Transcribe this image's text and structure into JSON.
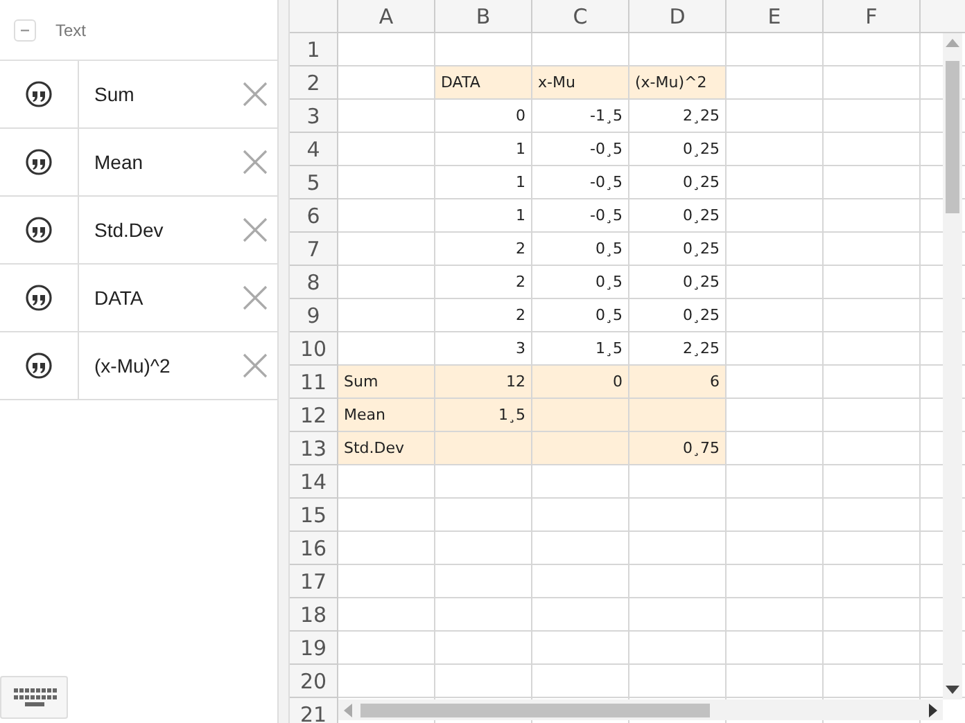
{
  "algebra_panel": {
    "group": {
      "label": "Text",
      "expanded": true
    },
    "items": [
      {
        "label": "Sum"
      },
      {
        "label": "Mean"
      },
      {
        "label": "Std.Dev"
      },
      {
        "label": "DATA"
      },
      {
        "label": "(x-Mu)^2"
      }
    ]
  },
  "spreadsheet": {
    "columns": [
      "A",
      "B",
      "C",
      "D",
      "E",
      "F"
    ],
    "rows": [
      {
        "number": "1",
        "cells": [
          {
            "highlighted": false
          },
          {
            "highlighted": false
          },
          {
            "highlighted": false
          },
          {
            "highlighted": false
          },
          {
            "highlighted": false
          },
          {
            "highlighted": false
          }
        ]
      },
      {
        "number": "2",
        "cells": [
          {
            "highlighted": false
          },
          {
            "text": "DATA",
            "kind": "text",
            "highlighted": true
          },
          {
            "text": "x-Mu",
            "kind": "text",
            "highlighted": true
          },
          {
            "text": "(x-Mu)^2",
            "kind": "text",
            "highlighted": true
          },
          {
            "highlighted": false
          },
          {
            "highlighted": false
          }
        ]
      },
      {
        "number": "3",
        "cells": [
          {
            "highlighted": false
          },
          {
            "text": "0",
            "kind": "number",
            "highlighted": false
          },
          {
            "text": "-1¸5",
            "kind": "number",
            "highlighted": false
          },
          {
            "text": "2¸25",
            "kind": "number",
            "highlighted": false
          },
          {
            "highlighted": false
          },
          {
            "highlighted": false
          }
        ]
      },
      {
        "number": "4",
        "cells": [
          {
            "highlighted": false
          },
          {
            "text": "1",
            "kind": "number",
            "highlighted": false
          },
          {
            "text": "-0¸5",
            "kind": "number",
            "highlighted": false
          },
          {
            "text": "0¸25",
            "kind": "number",
            "highlighted": false
          },
          {
            "highlighted": false
          },
          {
            "highlighted": false
          }
        ]
      },
      {
        "number": "5",
        "cells": [
          {
            "highlighted": false
          },
          {
            "text": "1",
            "kind": "number",
            "highlighted": false
          },
          {
            "text": "-0¸5",
            "kind": "number",
            "highlighted": false
          },
          {
            "text": "0¸25",
            "kind": "number",
            "highlighted": false
          },
          {
            "highlighted": false
          },
          {
            "highlighted": false
          }
        ]
      },
      {
        "number": "6",
        "cells": [
          {
            "highlighted": false
          },
          {
            "text": "1",
            "kind": "number",
            "highlighted": false
          },
          {
            "text": "-0¸5",
            "kind": "number",
            "highlighted": false
          },
          {
            "text": "0¸25",
            "kind": "number",
            "highlighted": false
          },
          {
            "highlighted": false
          },
          {
            "highlighted": false
          }
        ]
      },
      {
        "number": "7",
        "cells": [
          {
            "highlighted": false
          },
          {
            "text": "2",
            "kind": "number",
            "highlighted": false
          },
          {
            "text": "0¸5",
            "kind": "number",
            "highlighted": false
          },
          {
            "text": "0¸25",
            "kind": "number",
            "highlighted": false
          },
          {
            "highlighted": false
          },
          {
            "highlighted": false
          }
        ]
      },
      {
        "number": "8",
        "cells": [
          {
            "highlighted": false
          },
          {
            "text": "2",
            "kind": "number",
            "highlighted": false
          },
          {
            "text": "0¸5",
            "kind": "number",
            "highlighted": false
          },
          {
            "text": "0¸25",
            "kind": "number",
            "highlighted": false
          },
          {
            "highlighted": false
          },
          {
            "highlighted": false
          }
        ]
      },
      {
        "number": "9",
        "cells": [
          {
            "highlighted": false
          },
          {
            "text": "2",
            "kind": "number",
            "highlighted": false
          },
          {
            "text": "0¸5",
            "kind": "number",
            "highlighted": false
          },
          {
            "text": "0¸25",
            "kind": "number",
            "highlighted": false
          },
          {
            "highlighted": false
          },
          {
            "highlighted": false
          }
        ]
      },
      {
        "number": "10",
        "cells": [
          {
            "highlighted": false
          },
          {
            "text": "3",
            "kind": "number",
            "highlighted": false
          },
          {
            "text": "1¸5",
            "kind": "number",
            "highlighted": false
          },
          {
            "text": "2¸25",
            "kind": "number",
            "highlighted": false
          },
          {
            "highlighted": false
          },
          {
            "highlighted": false
          }
        ]
      },
      {
        "number": "11",
        "cells": [
          {
            "text": "Sum",
            "kind": "text",
            "highlighted": true
          },
          {
            "text": "12",
            "kind": "number",
            "highlighted": true
          },
          {
            "text": "0",
            "kind": "number",
            "highlighted": true
          },
          {
            "text": "6",
            "kind": "number",
            "highlighted": true
          },
          {
            "highlighted": false
          },
          {
            "highlighted": false
          }
        ]
      },
      {
        "number": "12",
        "cells": [
          {
            "text": "Mean",
            "kind": "text",
            "highlighted": true
          },
          {
            "text": "1¸5",
            "kind": "number",
            "highlighted": true
          },
          {
            "highlighted": true
          },
          {
            "highlighted": true
          },
          {
            "highlighted": false
          },
          {
            "highlighted": false
          }
        ]
      },
      {
        "number": "13",
        "cells": [
          {
            "text": "Std.Dev",
            "kind": "text",
            "highlighted": true
          },
          {
            "highlighted": true
          },
          {
            "highlighted": true
          },
          {
            "text": "0¸75",
            "kind": "number",
            "highlighted": true
          },
          {
            "highlighted": false
          },
          {
            "highlighted": false
          }
        ]
      },
      {
        "number": "14",
        "cells": [
          {
            "highlighted": false
          },
          {
            "highlighted": false
          },
          {
            "highlighted": false
          },
          {
            "highlighted": false
          },
          {
            "highlighted": false
          },
          {
            "highlighted": false
          }
        ]
      },
      {
        "number": "15",
        "cells": [
          {
            "highlighted": false
          },
          {
            "highlighted": false
          },
          {
            "highlighted": false
          },
          {
            "highlighted": false
          },
          {
            "highlighted": false
          },
          {
            "highlighted": false
          }
        ]
      },
      {
        "number": "16",
        "cells": [
          {
            "highlighted": false
          },
          {
            "highlighted": false
          },
          {
            "highlighted": false
          },
          {
            "highlighted": false
          },
          {
            "highlighted": false
          },
          {
            "highlighted": false
          }
        ]
      },
      {
        "number": "17",
        "cells": [
          {
            "highlighted": false
          },
          {
            "highlighted": false
          },
          {
            "highlighted": false
          },
          {
            "highlighted": false
          },
          {
            "highlighted": false
          },
          {
            "highlighted": false
          }
        ]
      },
      {
        "number": "18",
        "cells": [
          {
            "highlighted": false
          },
          {
            "highlighted": false
          },
          {
            "highlighted": false
          },
          {
            "highlighted": false
          },
          {
            "highlighted": false
          },
          {
            "highlighted": false
          }
        ]
      },
      {
        "number": "19",
        "cells": [
          {
            "highlighted": false
          },
          {
            "highlighted": false
          },
          {
            "highlighted": false
          },
          {
            "highlighted": false
          },
          {
            "highlighted": false
          },
          {
            "highlighted": false
          }
        ]
      },
      {
        "number": "20",
        "cells": [
          {
            "highlighted": false
          },
          {
            "highlighted": false
          },
          {
            "highlighted": false
          },
          {
            "highlighted": false
          },
          {
            "highlighted": false
          },
          {
            "highlighted": false
          }
        ]
      },
      {
        "number": "21",
        "cells": [
          {
            "highlighted": false
          },
          {
            "highlighted": false
          },
          {
            "highlighted": false
          },
          {
            "highlighted": false
          },
          {
            "highlighted": false
          },
          {
            "highlighted": false
          }
        ]
      }
    ]
  }
}
